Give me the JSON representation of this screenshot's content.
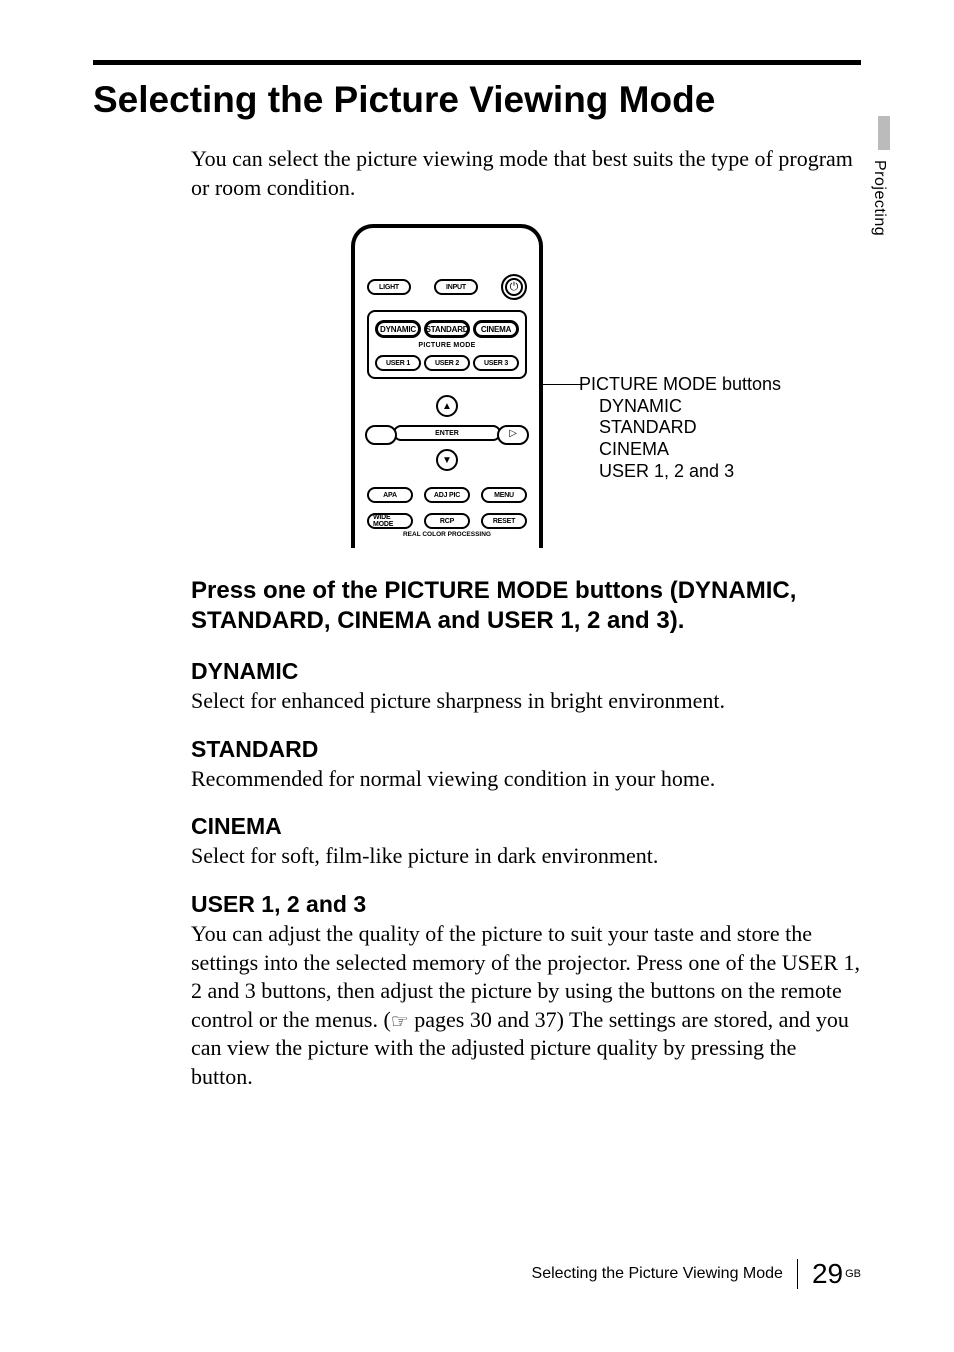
{
  "sideTab": "Projecting",
  "title": "Selecting the Picture Viewing Mode",
  "intro": "You can select the picture viewing mode that best suits the type of program or room condition.",
  "remote": {
    "top": {
      "light": "LIGHT",
      "input": "INPUT",
      "power": "⏻"
    },
    "modeBox": {
      "row1": {
        "dynamic": "DYNAMIC",
        "standard": "STANDARD",
        "cinema": "CINEMA"
      },
      "label": "PICTURE MODE",
      "row2": {
        "user1": "USER 1",
        "user2": "USER 2",
        "user3": "USER 3"
      }
    },
    "enter": "ENTER",
    "row3": {
      "apa": "APA",
      "adjpic": "ADJ PIC",
      "menu": "MENU"
    },
    "row4": {
      "wide": "WIDE MODE",
      "rcp": "RCP",
      "reset": "RESET"
    },
    "rcpLabel": "REAL COLOR PROCESSING"
  },
  "callout": {
    "title": "PICTURE MODE buttons",
    "items": [
      "DYNAMIC",
      "STANDARD",
      "CINEMA",
      "USER 1, 2 and 3"
    ]
  },
  "instruction": "Press one of the PICTURE MODE buttons (DYNAMIC, STANDARD, CINEMA and USER 1, 2 and 3).",
  "modes": {
    "dynamic": {
      "h": "DYNAMIC",
      "p": "Select for enhanced picture sharpness in bright environment."
    },
    "standard": {
      "h": "STANDARD",
      "p": "Recommended for normal viewing condition in your home."
    },
    "cinema": {
      "h": "CINEMA",
      "p": "Select for soft, film-like picture in dark environment."
    },
    "user": {
      "h": "USER 1, 2 and 3",
      "p1": "You can adjust the quality of the picture to suit your taste and store the settings into the selected memory of the projector. Press one of the USER 1, 2 and 3 buttons, then adjust the picture by using the buttons on the remote control or the menus. (",
      "ref": " pages 30 and  37",
      "p2": ") The settings are stored, and you can view the picture with the adjusted picture quality by pressing the button."
    }
  },
  "footer": {
    "title": "Selecting the Picture Viewing Mode",
    "page": "29",
    "lang": "GB"
  }
}
